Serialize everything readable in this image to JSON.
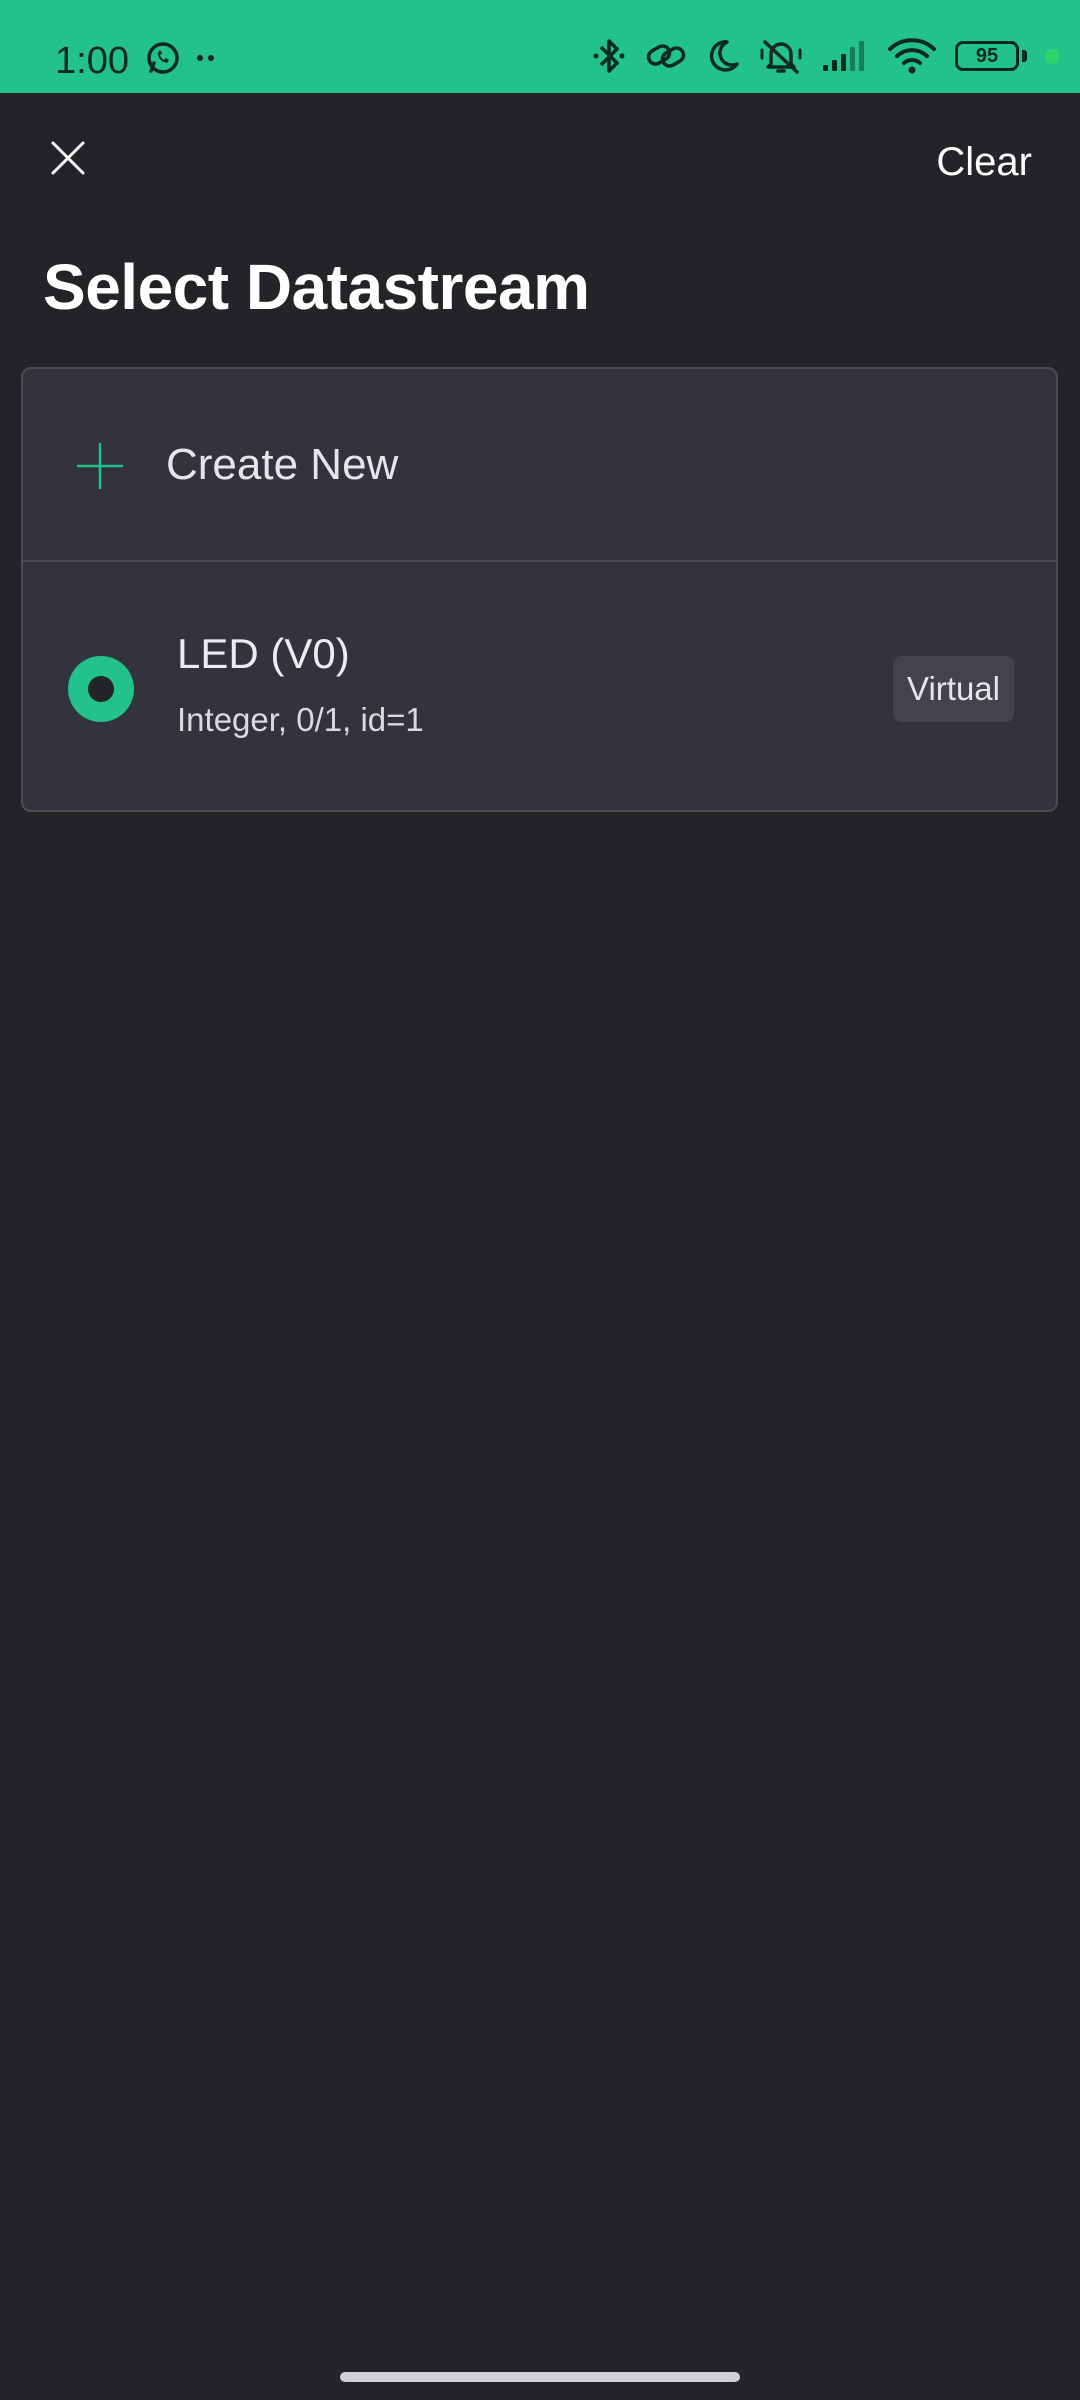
{
  "status_bar": {
    "time": "1:00",
    "battery_level": "95",
    "left_icons": [
      "whatsapp-icon",
      "more-dots-icon"
    ],
    "right_icons": [
      "bluetooth-icon",
      "link-icon",
      "moon-icon",
      "muted-bell-icon",
      "signal-icon",
      "wifi-icon",
      "battery-icon"
    ],
    "accent_color": "#23c18b"
  },
  "header": {
    "close_icon": "close-icon",
    "clear_label": "Clear",
    "title": "Select Datastream"
  },
  "list": {
    "create_new_label": "Create New",
    "create_new_icon": "plus-icon",
    "items": [
      {
        "name": "LED (V0)",
        "meta": "Integer, 0/1, id=1",
        "badge": "Virtual",
        "selected": true
      }
    ]
  },
  "colors": {
    "background": "#232428",
    "card": "#32333d",
    "accent": "#23c18b"
  }
}
